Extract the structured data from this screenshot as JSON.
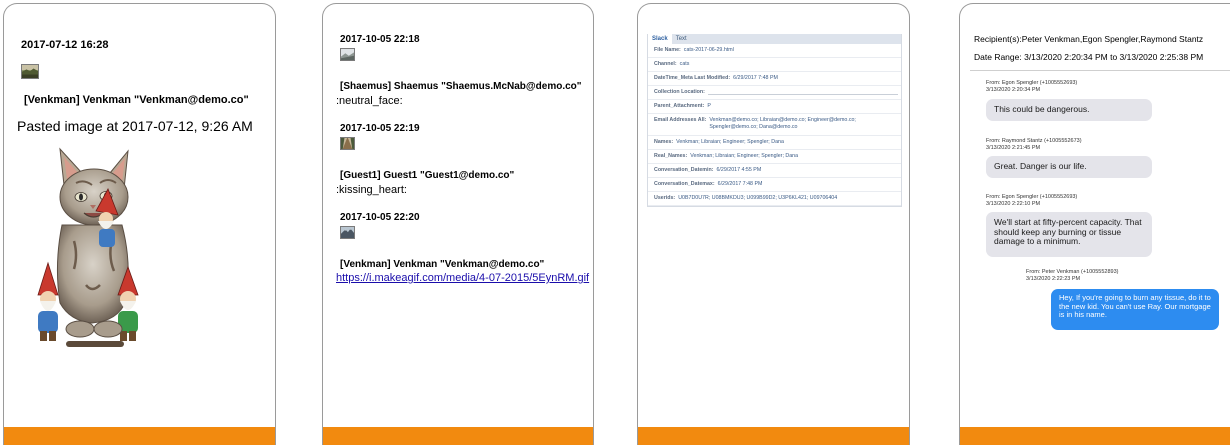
{
  "phone1": {
    "timestamp": "2017-07-12 16:28",
    "sender": "[Venkman] Venkman \"Venkman@demo.co\"",
    "caption": "Pasted image at 2017-07-12, 9:26 AM"
  },
  "phone2": {
    "messages": [
      {
        "time": "2017-10-05 22:18",
        "sender": "[Shaemus] Shaemus \"Shaemus.McNab@demo.co\"",
        "body": ":neutral_face:"
      },
      {
        "time": "2017-10-05 22:19",
        "sender": "[Guest1] Guest1 \"Guest1@demo.co\"",
        "body": ":kissing_heart:"
      },
      {
        "time": "2017-10-05 22:20",
        "sender": "[Venkman] Venkman \"Venkman@demo.co\"",
        "body": "https://i.makeagif.com/media/4-07-2015/5EynRM.gif"
      }
    ]
  },
  "phone3": {
    "tabs": [
      "Slack",
      "Text"
    ],
    "fields": [
      {
        "label": "File Name:",
        "value": "cats-2017-06-29.html"
      },
      {
        "label": "Channel:",
        "value": "cats"
      },
      {
        "label": "DateTime_Meta Last Modified:",
        "value": "6/29/2017 7:48 PM"
      },
      {
        "label": "Collection Location:",
        "value": ""
      },
      {
        "label": "Parent_Attachment:",
        "value": "P"
      },
      {
        "label": "Email Addresses All:",
        "value": "Venkman@demo.co; Libraian@demo.co; Engineer@demo.co; Spengler@demo.co; Dana@demo.co"
      },
      {
        "label": "Names:",
        "value": "Venkman; Libraian; Engineer; Spengler; Dana"
      },
      {
        "label": "Real_Names:",
        "value": "Venkman; Libraian; Engineer; Spengler; Dana"
      },
      {
        "label": "Conversation_Datemin:",
        "value": "6/29/2017 4:55 PM"
      },
      {
        "label": "Conversation_Datemax:",
        "value": "6/29/2017 7:48 PM"
      },
      {
        "label": "Userids:",
        "value": "U0B7D0U7R; U08BMKDU3; U099B99D2; U3P6KL421; U09706404"
      }
    ]
  },
  "phone4": {
    "recipients": "Recipient(s):Peter Venkman,Egon Spengler,Raymond Stantz",
    "date_range": "Date Range: 3/13/2020 2:20:34 PM to 3/13/2020 2:25:38 PM",
    "messages": [
      {
        "from": "From: Egon Spengler (+1005552693)",
        "time": "3/13/2020 2:20:34 PM",
        "text": "This could be dangerous."
      },
      {
        "from": "From: Raymond Stantz (+1005552673)",
        "time": "3/13/2020 2:21:45 PM",
        "text": "Great. Danger is our life."
      },
      {
        "from": "From: Egon Spengler (+1005552693)",
        "time": "3/13/2020 2:22:10 PM",
        "text": "We'll start at fifty-percent capacity. That should keep any burning or tissue damage to a minimum."
      },
      {
        "from": "From: Peter Venkman (+1005552893)",
        "time": "3/13/2020 2:22:23 PM",
        "text": "Hey, If you're going to burn any tissue, do it to the new kid. You can't use Ray. Our mortgage is in his name."
      }
    ]
  }
}
